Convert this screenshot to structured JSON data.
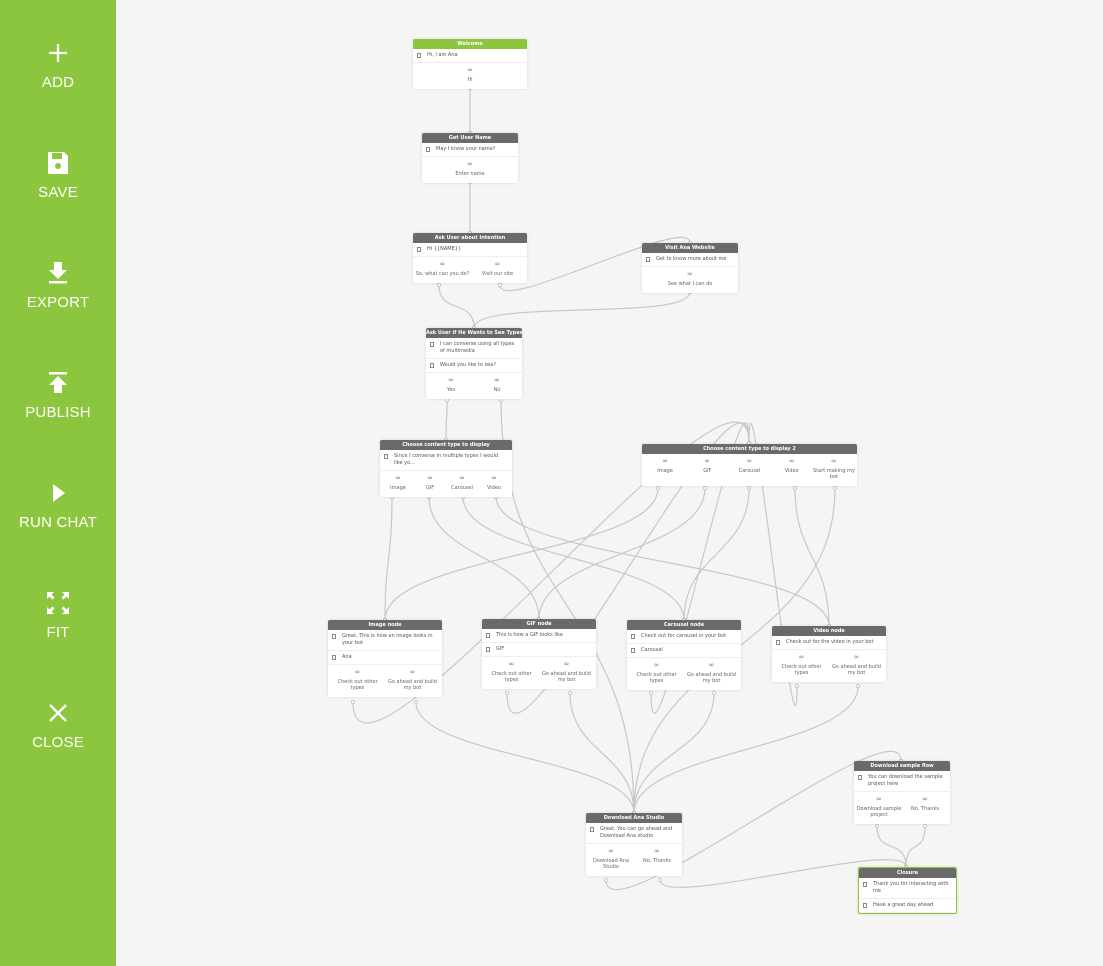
{
  "sidebar": {
    "items": [
      {
        "label": "ADD",
        "icon": "plus-icon"
      },
      {
        "label": "SAVE",
        "icon": "floppy-disk-icon"
      },
      {
        "label": "EXPORT",
        "icon": "download-icon"
      },
      {
        "label": "PUBLISH",
        "icon": "upload-icon"
      },
      {
        "label": "RUN CHAT",
        "icon": "play-icon"
      },
      {
        "label": "FIT",
        "icon": "expand-icon"
      },
      {
        "label": "CLOSE",
        "icon": "close-icon"
      }
    ]
  },
  "nodes": {
    "welcome": {
      "title": "Welcome",
      "rows": [
        "Hi, I am Ana"
      ],
      "buttons": [
        "Hi"
      ]
    },
    "get_user_name": {
      "title": "Get User Name",
      "rows": [
        "May I know your name?"
      ],
      "buttons": [
        "Enter name"
      ]
    },
    "ask_intention": {
      "title": "Ask User about Intention",
      "rows": [
        "Hi {{NAME}}"
      ],
      "buttons": [
        "So, what can you do?",
        "Visit our site"
      ]
    },
    "visit_website": {
      "title": "Visit Ana Website",
      "rows": [
        "Get to know more about me"
      ],
      "buttons": [
        "See what I can do"
      ]
    },
    "ask_types": {
      "title": "Ask User if He Wants to See Types of",
      "rows": [
        "I can converse using all types of multimedia",
        "Would you like to see?"
      ],
      "buttons": [
        "Yes",
        "No"
      ]
    },
    "choose_type": {
      "title": "Choose content type to display",
      "rows": [
        "Since I converse in multiple types I would like yo..."
      ],
      "buttons": [
        "Image",
        "GIF",
        "Carousel",
        "Video"
      ]
    },
    "choose_type_2": {
      "title": "Choose content type to display 2",
      "rows": [],
      "buttons": [
        "Image",
        "GIF",
        "Carousel",
        "Video",
        "Start making my bot"
      ]
    },
    "image_node": {
      "title": "Image node",
      "rows": [
        "Great, This is how an image looks in your bot",
        "Ana"
      ],
      "buttons": [
        "Check out other types",
        "Go ahead and build my bot"
      ]
    },
    "gif_node": {
      "title": "GIF node",
      "rows": [
        "This is how a GIF looks like",
        "GIF"
      ],
      "buttons": [
        "Check out other types",
        "Go ahead and build my bot"
      ]
    },
    "carousel_node": {
      "title": "Carousel node",
      "rows": [
        "Check out for carousel in your bot",
        "Carousel"
      ],
      "buttons": [
        "Check out other types",
        "Go ahead and build my bot"
      ]
    },
    "video_node": {
      "title": "Video node",
      "rows": [
        "Check out for the video in your bot"
      ],
      "buttons": [
        "Check out other types",
        "Go ahead and build my bot"
      ]
    },
    "download_studio": {
      "title": "Download Ana Studio",
      "rows": [
        "Great, You can go ahead and Download Ana studio"
      ],
      "buttons": [
        "Download Ana Studio",
        "No, Thanks"
      ]
    },
    "download_sample": {
      "title": "Download sample flow",
      "rows": [
        "You can download the sample project here"
      ],
      "buttons": [
        "Download sample project",
        "No, Thanks"
      ]
    },
    "closure": {
      "title": "Closure",
      "rows": [
        "Thank you for interacting with me",
        "Have a great day ahead"
      ],
      "buttons": []
    }
  },
  "colors": {
    "accent": "#8cc63f",
    "node_header": "#6a6a6a",
    "edge": "#c8c8c8",
    "canvas": "#f5f5f5"
  }
}
